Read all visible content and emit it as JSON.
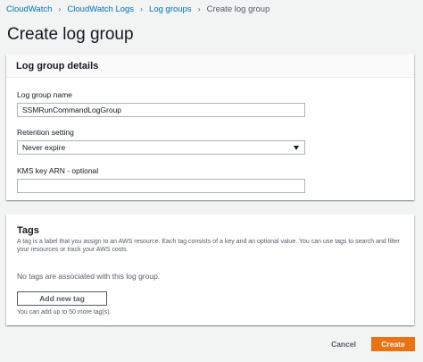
{
  "breadcrumb": {
    "items": [
      "CloudWatch",
      "CloudWatch Logs",
      "Log groups"
    ],
    "current": "Create log group",
    "separator": "›"
  },
  "page": {
    "title": "Create log group"
  },
  "details": {
    "heading": "Log group details",
    "name_label": "Log group name",
    "name_value": "SSMRunCommandLogGroup",
    "retention_label": "Retention setting",
    "retention_value": "Never expire",
    "kms_label": "KMS key ARN - optional",
    "kms_value": ""
  },
  "tags": {
    "heading": "Tags",
    "description": "A tag is a label that you assign to an AWS resource. Each tag consists of a key and an optional value. You can use tags to search and filter your resources or track your AWS costs.",
    "empty_text": "No tags are associated with this log group.",
    "add_label": "Add new tag",
    "hint": "You can add up to 50 more tag(s)."
  },
  "actions": {
    "cancel_label": "Cancel",
    "create_label": "Create"
  },
  "colors": {
    "link": "#0073bb",
    "primary": "#ec7211",
    "background": "#f2f3f3"
  },
  "icons": {
    "separator": "chevron-right-icon",
    "dropdown": "caret-down-icon"
  }
}
